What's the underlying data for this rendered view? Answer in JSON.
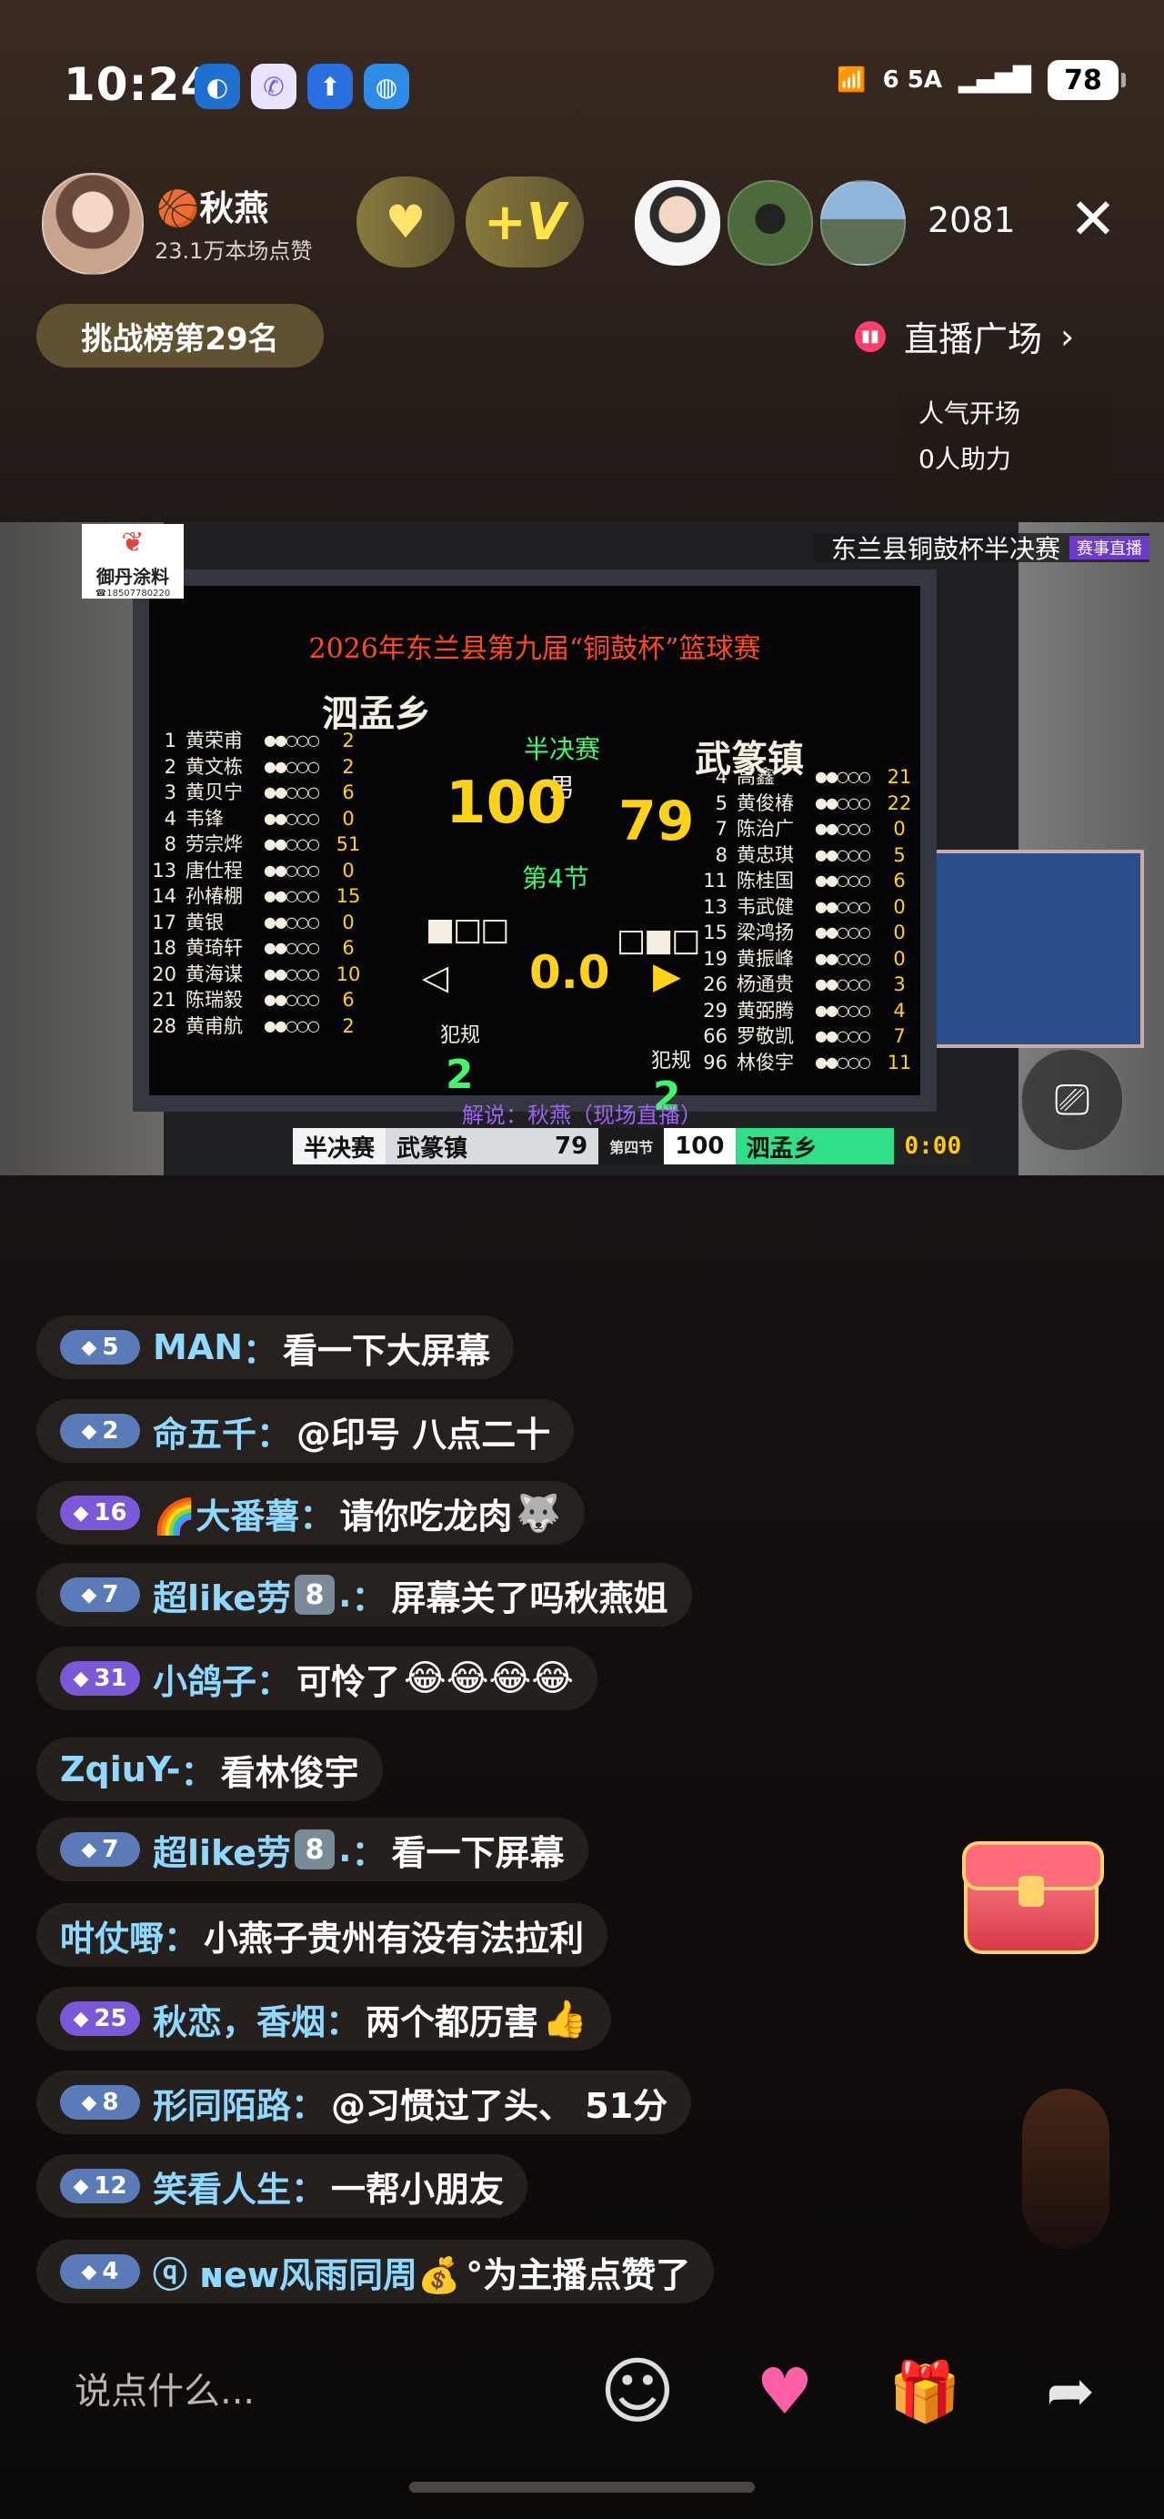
{
  "status_bar": {
    "time": "10:24",
    "apps": [
      "browser-icon",
      "phone-icon",
      "upload-icon",
      "globe-icon"
    ],
    "network": "6 5A",
    "battery": "78"
  },
  "header": {
    "streamer_name": "🏀秋燕",
    "likes": "23.1万本场点赞",
    "viewer_count": "2081",
    "close": "✕",
    "rank_badge": "挑战榜第29名",
    "plaza": "直播广场",
    "popularity_line1": "人气开场",
    "popularity_line2": "0人助力"
  },
  "video": {
    "live_title": "东兰县铜鼓杯半决赛",
    "live_tag": "赛事直播",
    "sponsor_name": "御丹涂料",
    "sponsor_tel": "☎18507780220",
    "scoreboard": {
      "title": "2026年东兰县第九届“铜鼓杯”篮球赛",
      "team_left": "泗孟乡",
      "team_right": "武篆镇",
      "stage": "半决赛",
      "gender": "男",
      "score_left": "100",
      "score_right": "79",
      "period": "第4节",
      "clock": "0.0",
      "fouls_label": "犯规",
      "fouls_left": "2",
      "fouls_right": "2",
      "roster_left": [
        {
          "num": "1",
          "name": "黄荣甫",
          "pts": "2"
        },
        {
          "num": "2",
          "name": "黄文栋",
          "pts": "2"
        },
        {
          "num": "3",
          "name": "黄贝宁",
          "pts": "6"
        },
        {
          "num": "4",
          "name": "韦锋",
          "pts": "0"
        },
        {
          "num": "8",
          "name": "劳宗烨",
          "pts": "51"
        },
        {
          "num": "13",
          "name": "唐仕程",
          "pts": "0"
        },
        {
          "num": "14",
          "name": "孙椿棚",
          "pts": "15"
        },
        {
          "num": "17",
          "name": "黄银",
          "pts": "0"
        },
        {
          "num": "18",
          "name": "黄琦轩",
          "pts": "6"
        },
        {
          "num": "20",
          "name": "黄海谋",
          "pts": "10"
        },
        {
          "num": "21",
          "name": "陈瑞毅",
          "pts": "6"
        },
        {
          "num": "28",
          "name": "黄甫航",
          "pts": "2"
        }
      ],
      "roster_right": [
        {
          "num": "4",
          "name": "高鑫",
          "pts": "21"
        },
        {
          "num": "5",
          "name": "黄俊椿",
          "pts": "22"
        },
        {
          "num": "7",
          "name": "陈治广",
          "pts": "0"
        },
        {
          "num": "8",
          "name": "黄忠琪",
          "pts": "5"
        },
        {
          "num": "11",
          "name": "陈桂国",
          "pts": "6"
        },
        {
          "num": "13",
          "name": "韦武健",
          "pts": "0"
        },
        {
          "num": "15",
          "name": "梁鸿扬",
          "pts": "0"
        },
        {
          "num": "19",
          "name": "黄振峰",
          "pts": "0"
        },
        {
          "num": "26",
          "name": "杨通贵",
          "pts": "3"
        },
        {
          "num": "29",
          "name": "黄弼腾",
          "pts": "4"
        },
        {
          "num": "66",
          "name": "罗敬凯",
          "pts": "7"
        },
        {
          "num": "96",
          "name": "林俊宇",
          "pts": "11"
        }
      ]
    },
    "commentator": "解说：秋燕（现场直播）",
    "strip": {
      "stage": "半决赛",
      "team_a": "武篆镇",
      "score_a": "79",
      "period": "第四节",
      "score_b": "100",
      "team_b": "泗孟乡",
      "clock": "0:00"
    }
  },
  "chat": [
    {
      "level": "5",
      "user": "MAN",
      "msg": "看一下大屏幕"
    },
    {
      "level": "2",
      "user": "命五千",
      "msg": "@印号 八点二十"
    },
    {
      "level": "16",
      "user": "🌈大番薯",
      "msg": "请你吃龙肉",
      "emoji": "🐺"
    },
    {
      "level": "7",
      "user": "超like劳",
      "fan": "8",
      "user_suffix": ".",
      "msg": "屏幕关了吗秋燕姐"
    },
    {
      "level": "31",
      "user": "小鸽子",
      "msg": "可怜了",
      "emoji": "😂😂😂😂"
    },
    {
      "user": "ZqiuY-",
      "msg": "看林俊宇"
    },
    {
      "level": "7",
      "user": "超like劳",
      "fan": "8",
      "user_suffix": ".",
      "msg": "看一下屏幕"
    },
    {
      "user": "咁仗嘢",
      "msg": "小燕子贵州有没有法拉利"
    },
    {
      "level": "25",
      "user": "秋恋，香烟",
      "msg": "两个都历害",
      "emoji": "👍"
    },
    {
      "level": "8",
      "user": "形同陌路",
      "msg": "@习惯过了头、 51分"
    },
    {
      "level": "12",
      "user": "笑看人生",
      "msg": "一帮小朋友"
    },
    {
      "level": "4",
      "user": "ⓠ ɴew风雨同周💰",
      "msg": "°为主播点赞了"
    }
  ],
  "bottom_bar": {
    "input_placeholder": "说点什么..."
  }
}
